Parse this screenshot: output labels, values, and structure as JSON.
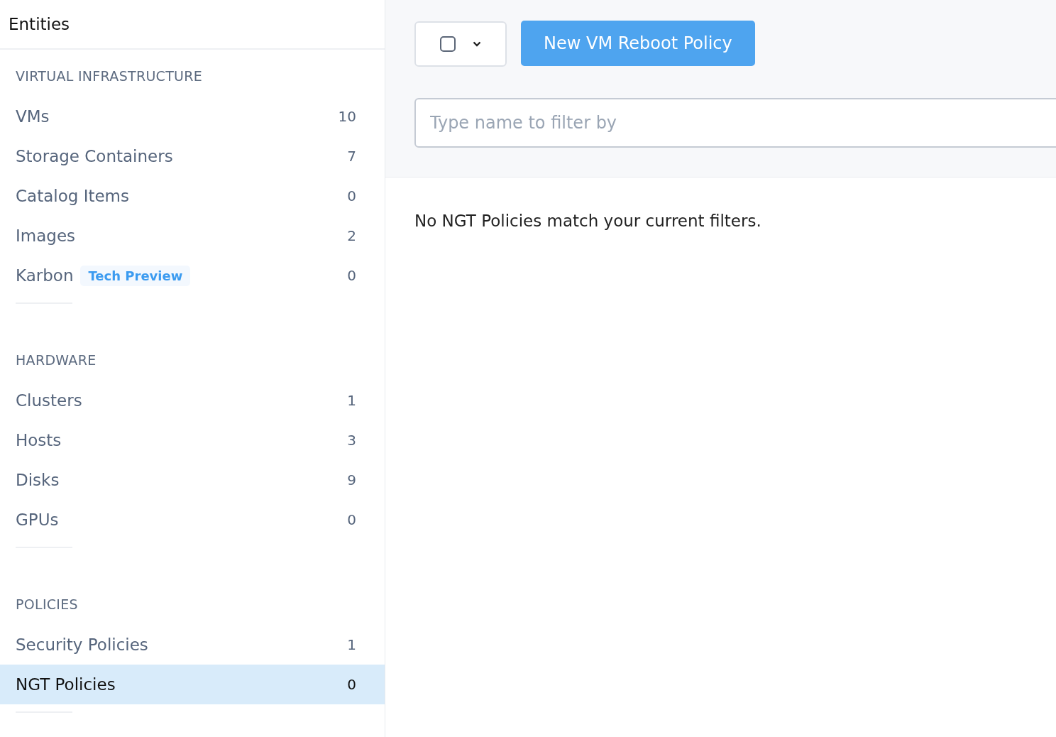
{
  "sidebar": {
    "title": "Entities",
    "sections": [
      {
        "heading": "VIRTUAL INFRASTRUCTURE",
        "items": [
          {
            "label": "VMs",
            "count": "10",
            "selected": false
          },
          {
            "label": "Storage Containers",
            "count": "7",
            "selected": false
          },
          {
            "label": "Catalog Items",
            "count": "0",
            "selected": false
          },
          {
            "label": "Images",
            "count": "2",
            "selected": false
          },
          {
            "label": "Karbon",
            "badge": "Tech Preview",
            "count": "0",
            "selected": false
          }
        ]
      },
      {
        "heading": "HARDWARE",
        "items": [
          {
            "label": "Clusters",
            "count": "1",
            "selected": false
          },
          {
            "label": "Hosts",
            "count": "3",
            "selected": false
          },
          {
            "label": "Disks",
            "count": "9",
            "selected": false
          },
          {
            "label": "GPUs",
            "count": "0",
            "selected": false
          }
        ]
      },
      {
        "heading": "POLICIES",
        "items": [
          {
            "label": "Security Policies",
            "count": "1",
            "selected": false
          },
          {
            "label": "NGT Policies",
            "count": "0",
            "selected": true
          }
        ]
      }
    ]
  },
  "toolbar": {
    "select_all": {
      "checked": false
    },
    "primary_button": "New VM Reboot Policy"
  },
  "filter": {
    "placeholder": "Type name to filter by"
  },
  "empty_message": "No NGT Policies match your current filters."
}
